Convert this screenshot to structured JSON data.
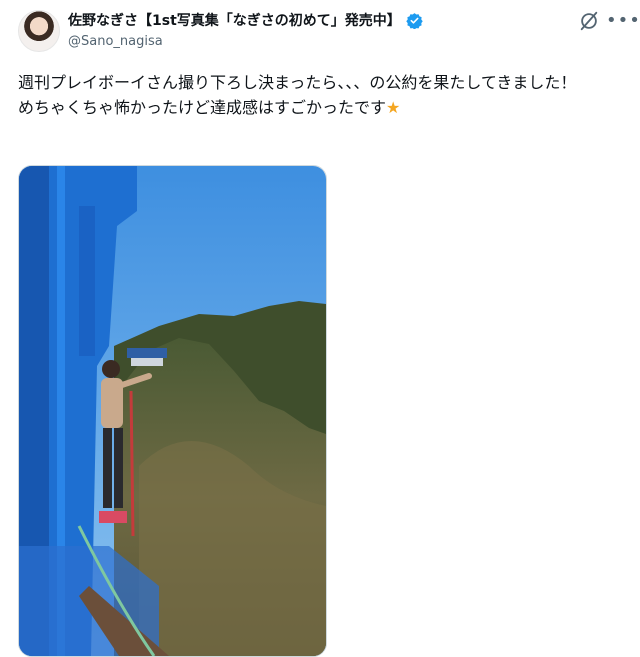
{
  "author": {
    "display_name": "佐野なぎさ【1st写真集「なぎさの初めて」発売中】",
    "handle": "@Sano_nagisa",
    "verified": true
  },
  "post": {
    "line1": "週刊プレイボーイさん撮り下ろし決まったら、、、の公約を果たしてきました！",
    "line2": "めちゃくちゃ怖かったけど達成感はすごかったです",
    "emoji": "★"
  },
  "icons": {
    "verified": "verified-badge-icon",
    "grok": "grok-icon",
    "more": "more-icon"
  },
  "colors": {
    "verified_blue": "#1d9bf0",
    "text": "#0f1419",
    "secondary": "#536471",
    "bridge_blue": "#1e6fd1",
    "sky": "#5da9ea"
  },
  "media": {
    "type": "photo"
  }
}
